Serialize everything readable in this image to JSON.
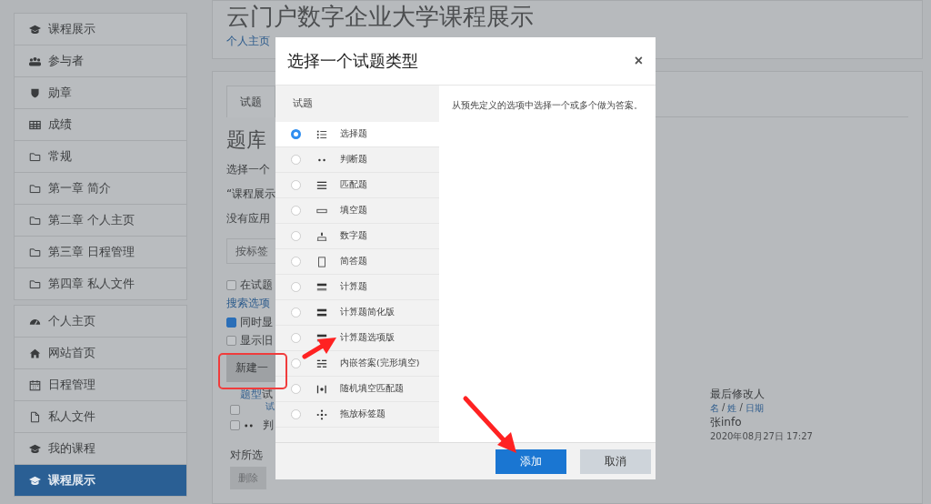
{
  "sidebar": {
    "groups": [
      {
        "items": [
          {
            "label": "课程展示",
            "selected": false
          },
          {
            "label": "参与者",
            "selected": false
          },
          {
            "label": "勋章",
            "selected": false
          },
          {
            "label": "成绩",
            "selected": false
          },
          {
            "label": "常规",
            "selected": false
          },
          {
            "label": "第一章 简介",
            "selected": false
          },
          {
            "label": "第二章 个人主页",
            "selected": false
          },
          {
            "label": "第三章 日程管理",
            "selected": false
          },
          {
            "label": "第四章 私人文件",
            "selected": false
          }
        ]
      },
      {
        "items": [
          {
            "label": "个人主页",
            "selected": false
          },
          {
            "label": "网站首页",
            "selected": false
          },
          {
            "label": "日程管理",
            "selected": false
          },
          {
            "label": "私人文件",
            "selected": false
          },
          {
            "label": "我的课程",
            "selected": false
          },
          {
            "label": "课程展示",
            "selected": true
          }
        ]
      }
    ]
  },
  "header": {
    "title": "云门户数字企业大学课程展示",
    "breadcrumb": [
      "个人主页"
    ]
  },
  "content": {
    "tab": "试题",
    "heading": "题库",
    "lines": [
      "选择一个",
      "“课程展示",
      "没有应用"
    ],
    "tag_filter": {
      "placeholder": "按标签"
    },
    "options": [
      {
        "label": "在试题",
        "checked": false
      }
    ],
    "search_link": "搜索选项",
    "options2": [
      {
        "label": "同时显",
        "checked": true
      },
      {
        "label": "显示旧",
        "checked": false
      }
    ],
    "new_button": "新建一",
    "table": {
      "header": [
        "题型",
        "试"
      ],
      "rows": [
        {
          "checked": false,
          "text": "试"
        },
        {
          "checked": false,
          "text": "判"
        }
      ],
      "modified_header": "最后修改人",
      "modified_sort": [
        {
          "text": "名",
          "kind": "link"
        },
        {
          "text": "/",
          "kind": "separator"
        },
        {
          "text": "姓",
          "kind": "link"
        },
        {
          "text": "/",
          "kind": "separator"
        },
        {
          "text": "日期",
          "kind": "link"
        }
      ],
      "modified_by": "张info",
      "modified_date": "2020年08月27日 17:27"
    },
    "bulk_label": "对所选",
    "delete_button": "删除"
  },
  "dialog": {
    "title": "选择一个试题类型",
    "close": "×",
    "list_header": "试题",
    "types": [
      {
        "label": "选择题",
        "selected": true
      },
      {
        "label": "判断题",
        "selected": false
      },
      {
        "label": "匹配题",
        "selected": false
      },
      {
        "label": "填空题",
        "selected": false
      },
      {
        "label": "数字题",
        "selected": false
      },
      {
        "label": "简答题",
        "selected": false
      },
      {
        "label": "计算题",
        "selected": false
      },
      {
        "label": "计算题简化版",
        "selected": false
      },
      {
        "label": "计算题选项版",
        "selected": false
      },
      {
        "label": "内嵌答案(完形填空)",
        "selected": false
      },
      {
        "label": "随机填空匹配题",
        "selected": false
      },
      {
        "label": "拖放标签题",
        "selected": false
      }
    ],
    "description": "从预先定义的选项中选择一个或多个做为答案。",
    "buttons": [
      {
        "label": "添加",
        "kind": "primary"
      },
      {
        "label": "取消",
        "kind": "secondary"
      }
    ]
  }
}
